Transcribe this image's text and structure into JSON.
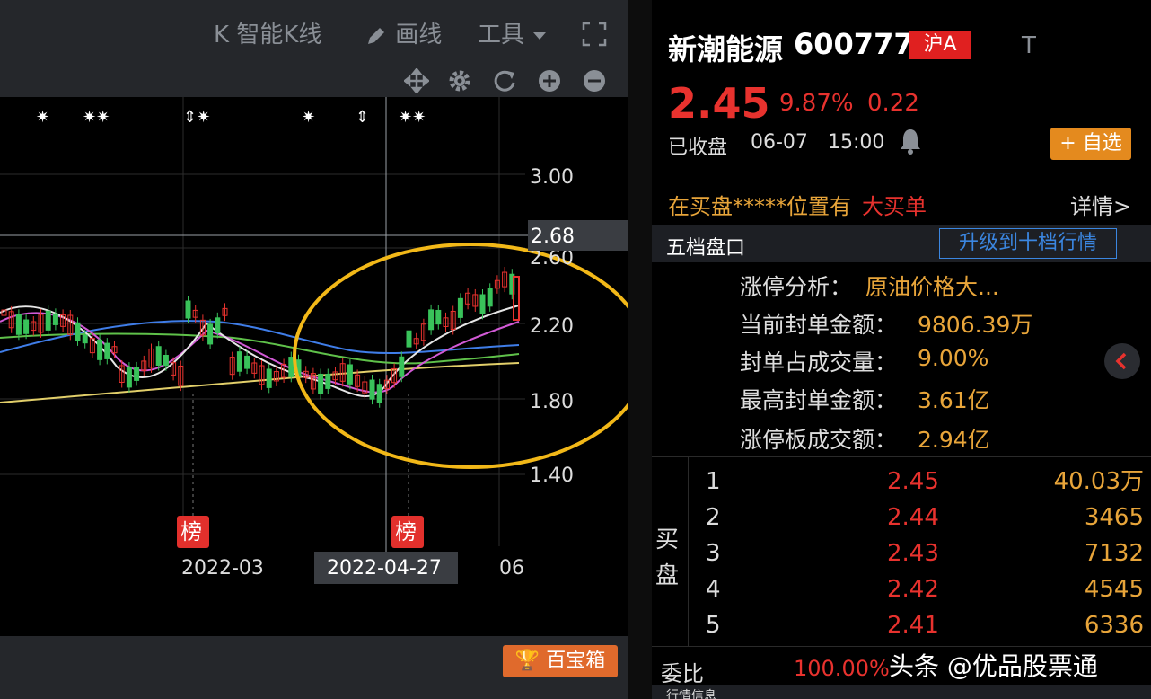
{
  "toolbar": {
    "smart_k": "K 智能K线",
    "draw": "画线",
    "tools": "工具"
  },
  "chart": {
    "y_ticks": [
      "3.00",
      "2.68",
      "2.60",
      "2.20",
      "1.80",
      "1.40"
    ],
    "x_labels": [
      "2022-03",
      "2022-04-27",
      "06"
    ],
    "badge_label": "榜",
    "crosshair_price": "2.68"
  },
  "bottom": {
    "treasure_label": "百宝箱"
  },
  "stock": {
    "name": "新潮能源",
    "code": "600777",
    "market": "沪A",
    "t_label": "T",
    "price": "2.45",
    "change_pct": "9.87%",
    "change": "0.22",
    "status": "已收盘",
    "date": "06-07",
    "time": "15:00",
    "add_fav": "+ 自选"
  },
  "alert": {
    "text": "在买盘*****位置有",
    "highlight": "大买单",
    "detail": "详情>"
  },
  "order_section": {
    "title": "五档盘口",
    "upgrade": "升级到十档行情"
  },
  "limit_up": {
    "analysis_label": "涨停分析：",
    "analysis_value": "原油价格大...",
    "seal_amount_label": "当前封单金额：",
    "seal_amount_value": "9806.39万",
    "seal_ratio_label": "封单占成交量：",
    "seal_ratio_value": "9.00%",
    "max_seal_label": "最高封单金额：",
    "max_seal_value": "3.61亿",
    "turnover_label": "涨停板成交额：",
    "turnover_value": "2.94亿"
  },
  "bid": {
    "side_label_1": "买",
    "side_label_2": "盘",
    "levels": [
      {
        "level": "1",
        "price": "2.45",
        "volume": "40.03万"
      },
      {
        "level": "2",
        "price": "2.44",
        "volume": "3465"
      },
      {
        "level": "3",
        "price": "2.43",
        "volume": "7132"
      },
      {
        "level": "4",
        "price": "2.42",
        "volume": "4545"
      },
      {
        "level": "5",
        "price": "2.41",
        "volume": "6336"
      }
    ]
  },
  "ratio": {
    "label": "委比",
    "value": "100.00%"
  },
  "lower_section": {
    "title": "行情信息"
  },
  "watermark": "头条 @优品股票通",
  "colors": {
    "up": "#e8322e",
    "gold": "#e8a53a",
    "blue": "#3b86e0",
    "circle": "#f2b818"
  }
}
